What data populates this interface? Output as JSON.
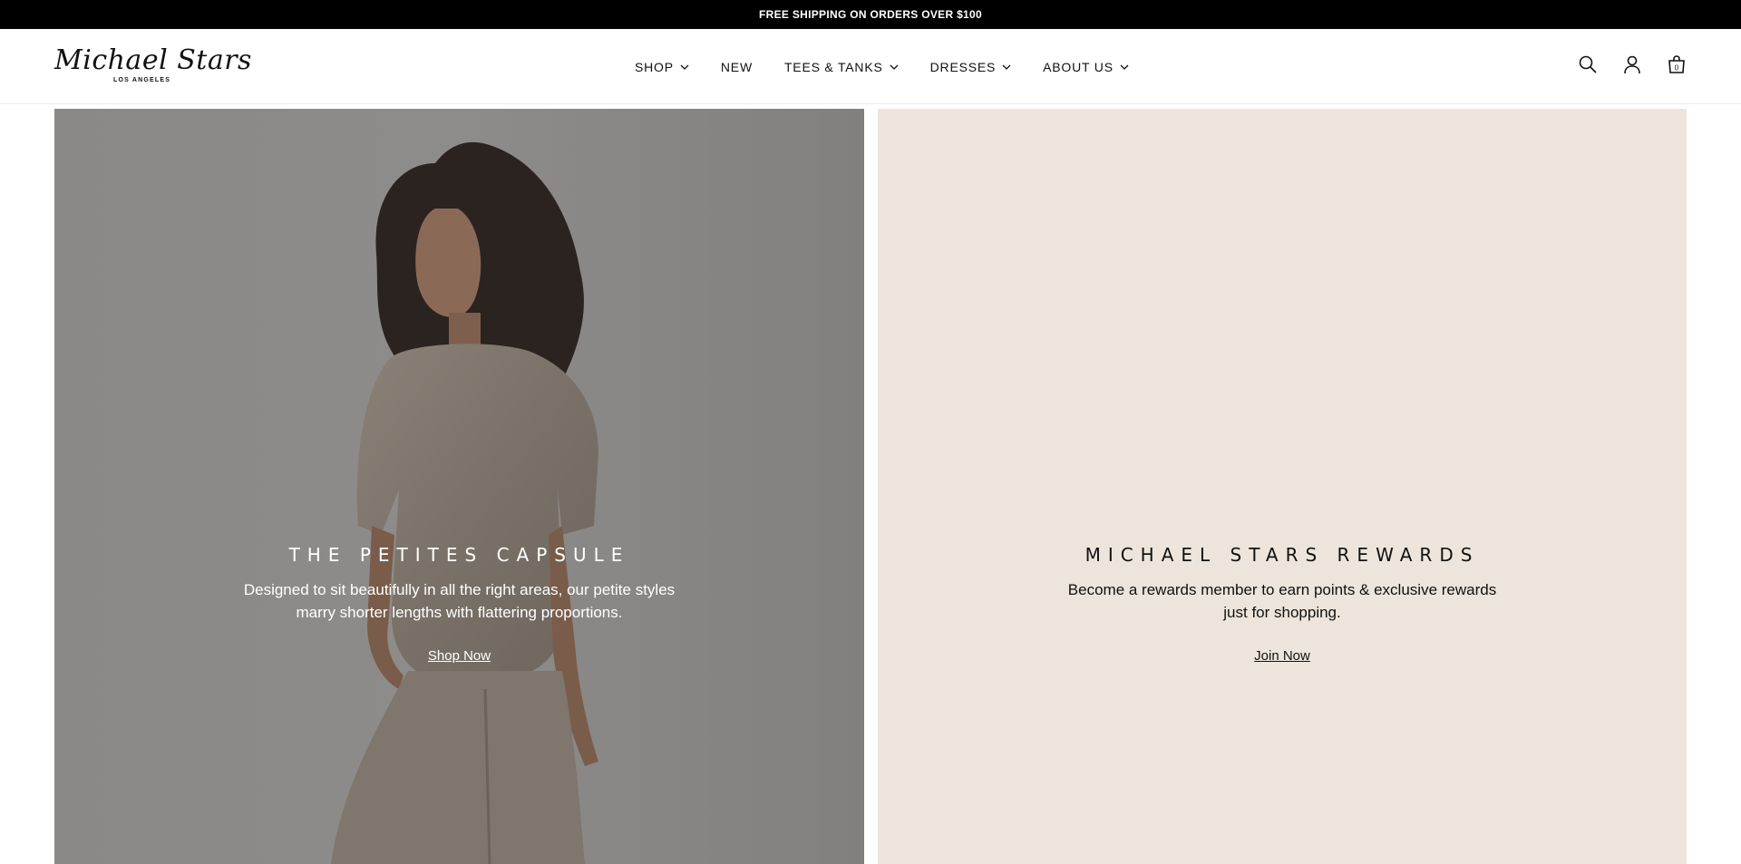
{
  "announcement": {
    "text": "FREE SHIPPING ON ORDERS OVER $100"
  },
  "brand": {
    "name": "Michael Stars",
    "tagline": "LOS ANGELES"
  },
  "nav": {
    "items": [
      {
        "label": "SHOP",
        "has_dropdown": true
      },
      {
        "label": "NEW",
        "has_dropdown": false
      },
      {
        "label": "TEES & TANKS",
        "has_dropdown": true
      },
      {
        "label": "DRESSES",
        "has_dropdown": true
      },
      {
        "label": "ABOUT US",
        "has_dropdown": true
      }
    ]
  },
  "header_icons": {
    "search": "search-icon",
    "account": "account-icon",
    "cart": "cart-icon",
    "cart_count": "0"
  },
  "promo_left": {
    "title": "THE PETITES CAPSULE",
    "body": "Designed to sit beautifully in all the right areas, our petite styles marry shorter lengths with flattering proportions.",
    "cta": "Shop Now"
  },
  "promo_right": {
    "title": "MICHAEL STARS REWARDS",
    "body": "Become a rewards member to earn points & exclusive rewards just for shopping.",
    "cta": "Join Now"
  },
  "colors": {
    "announcement_bg": "#000000",
    "left_panel_bg": "#878583",
    "right_panel_bg": "#ede5db"
  }
}
